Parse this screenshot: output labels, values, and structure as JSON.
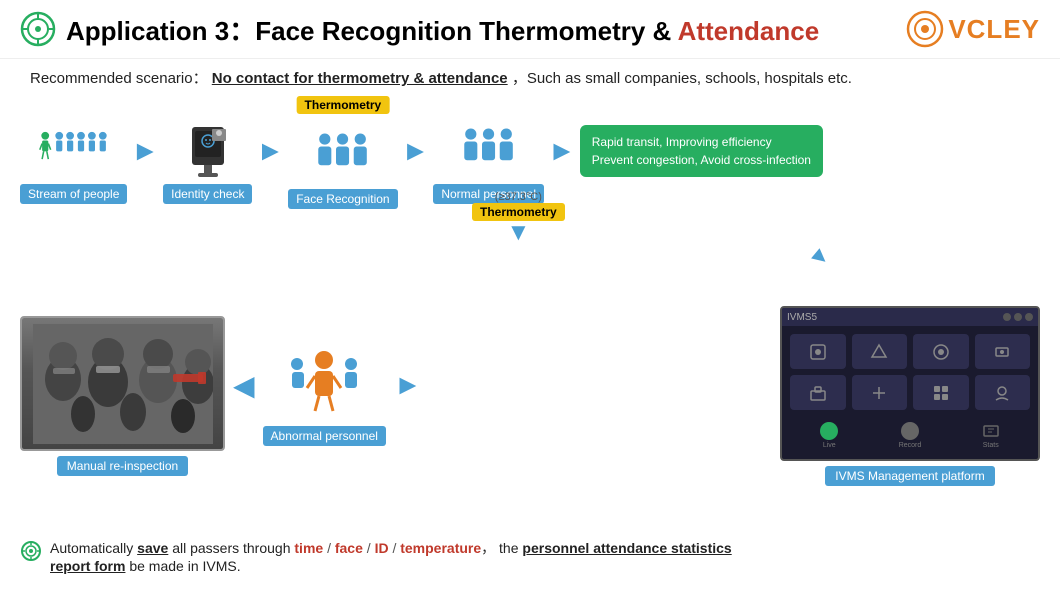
{
  "header": {
    "app_label": "Application 3：",
    "title_main": "Face Recognition Thermometry & ",
    "title_accent": "Attendance",
    "logo": "VCLEY"
  },
  "scenario": {
    "prefix": "Recommended scenario：",
    "highlight": "No contact for thermometry & attendance",
    "suffix": "，Such as small companies, schools, hospitals etc."
  },
  "flow": {
    "steps": [
      {
        "label": "Stream of people"
      },
      {
        "label": "Identity check"
      },
      {
        "label": "Face Recognition"
      },
      {
        "label": "Normal personnel"
      }
    ],
    "thermo_badge": "Thermometry",
    "green_box_line1": "Rapid transit, Improving efficiency",
    "green_box_line2": "Prevent congestion, Avoid cross-infection",
    "temp_threshold": "(≥37.3°C)",
    "thermo_badge2": "Thermometry",
    "abnormal_label": "Abnormal personnel",
    "manual_label": "Manual re-inspection",
    "ivms_label": "IVMS Management platform",
    "ivms_title": "IVMS5"
  },
  "bottom_text": {
    "intro": "Automatically ",
    "save_bold": "save",
    "middle": " all passers through ",
    "time": "time",
    "slash1": " / ",
    "face": "face",
    "slash2": " / ",
    "id": "ID",
    "slash3": " / ",
    "temperature": "temperature",
    "comma": "，",
    "the": " the ",
    "stats": "personnel attendance statistics",
    "report": "report form",
    "end": " be made in IVMS."
  }
}
